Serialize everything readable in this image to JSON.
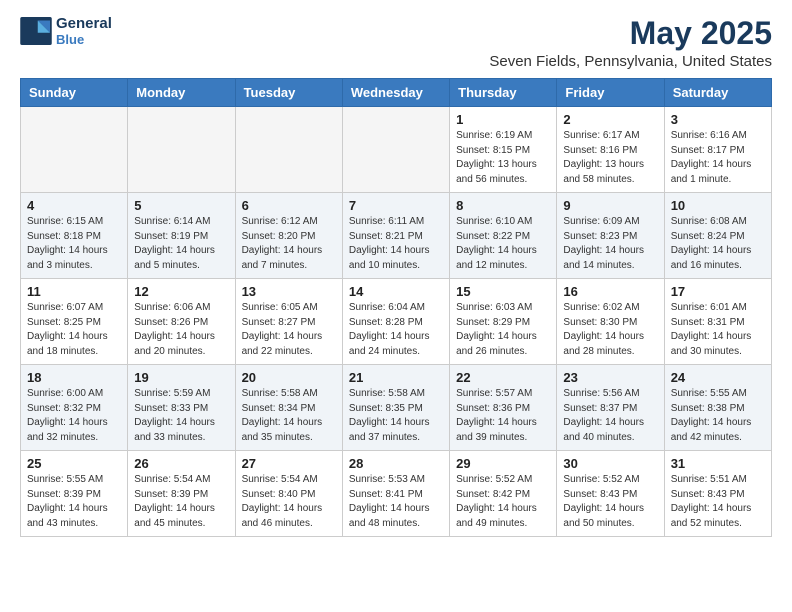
{
  "header": {
    "logo_line1": "General",
    "logo_line2": "Blue",
    "title": "May 2025",
    "subtitle": "Seven Fields, Pennsylvania, United States"
  },
  "days_of_week": [
    "Sunday",
    "Monday",
    "Tuesday",
    "Wednesday",
    "Thursday",
    "Friday",
    "Saturday"
  ],
  "weeks": [
    [
      {
        "day": "",
        "info": ""
      },
      {
        "day": "",
        "info": ""
      },
      {
        "day": "",
        "info": ""
      },
      {
        "day": "",
        "info": ""
      },
      {
        "day": "1",
        "info": "Sunrise: 6:19 AM\nSunset: 8:15 PM\nDaylight: 13 hours\nand 56 minutes."
      },
      {
        "day": "2",
        "info": "Sunrise: 6:17 AM\nSunset: 8:16 PM\nDaylight: 13 hours\nand 58 minutes."
      },
      {
        "day": "3",
        "info": "Sunrise: 6:16 AM\nSunset: 8:17 PM\nDaylight: 14 hours\nand 1 minute."
      }
    ],
    [
      {
        "day": "4",
        "info": "Sunrise: 6:15 AM\nSunset: 8:18 PM\nDaylight: 14 hours\nand 3 minutes."
      },
      {
        "day": "5",
        "info": "Sunrise: 6:14 AM\nSunset: 8:19 PM\nDaylight: 14 hours\nand 5 minutes."
      },
      {
        "day": "6",
        "info": "Sunrise: 6:12 AM\nSunset: 8:20 PM\nDaylight: 14 hours\nand 7 minutes."
      },
      {
        "day": "7",
        "info": "Sunrise: 6:11 AM\nSunset: 8:21 PM\nDaylight: 14 hours\nand 10 minutes."
      },
      {
        "day": "8",
        "info": "Sunrise: 6:10 AM\nSunset: 8:22 PM\nDaylight: 14 hours\nand 12 minutes."
      },
      {
        "day": "9",
        "info": "Sunrise: 6:09 AM\nSunset: 8:23 PM\nDaylight: 14 hours\nand 14 minutes."
      },
      {
        "day": "10",
        "info": "Sunrise: 6:08 AM\nSunset: 8:24 PM\nDaylight: 14 hours\nand 16 minutes."
      }
    ],
    [
      {
        "day": "11",
        "info": "Sunrise: 6:07 AM\nSunset: 8:25 PM\nDaylight: 14 hours\nand 18 minutes."
      },
      {
        "day": "12",
        "info": "Sunrise: 6:06 AM\nSunset: 8:26 PM\nDaylight: 14 hours\nand 20 minutes."
      },
      {
        "day": "13",
        "info": "Sunrise: 6:05 AM\nSunset: 8:27 PM\nDaylight: 14 hours\nand 22 minutes."
      },
      {
        "day": "14",
        "info": "Sunrise: 6:04 AM\nSunset: 8:28 PM\nDaylight: 14 hours\nand 24 minutes."
      },
      {
        "day": "15",
        "info": "Sunrise: 6:03 AM\nSunset: 8:29 PM\nDaylight: 14 hours\nand 26 minutes."
      },
      {
        "day": "16",
        "info": "Sunrise: 6:02 AM\nSunset: 8:30 PM\nDaylight: 14 hours\nand 28 minutes."
      },
      {
        "day": "17",
        "info": "Sunrise: 6:01 AM\nSunset: 8:31 PM\nDaylight: 14 hours\nand 30 minutes."
      }
    ],
    [
      {
        "day": "18",
        "info": "Sunrise: 6:00 AM\nSunset: 8:32 PM\nDaylight: 14 hours\nand 32 minutes."
      },
      {
        "day": "19",
        "info": "Sunrise: 5:59 AM\nSunset: 8:33 PM\nDaylight: 14 hours\nand 33 minutes."
      },
      {
        "day": "20",
        "info": "Sunrise: 5:58 AM\nSunset: 8:34 PM\nDaylight: 14 hours\nand 35 minutes."
      },
      {
        "day": "21",
        "info": "Sunrise: 5:58 AM\nSunset: 8:35 PM\nDaylight: 14 hours\nand 37 minutes."
      },
      {
        "day": "22",
        "info": "Sunrise: 5:57 AM\nSunset: 8:36 PM\nDaylight: 14 hours\nand 39 minutes."
      },
      {
        "day": "23",
        "info": "Sunrise: 5:56 AM\nSunset: 8:37 PM\nDaylight: 14 hours\nand 40 minutes."
      },
      {
        "day": "24",
        "info": "Sunrise: 5:55 AM\nSunset: 8:38 PM\nDaylight: 14 hours\nand 42 minutes."
      }
    ],
    [
      {
        "day": "25",
        "info": "Sunrise: 5:55 AM\nSunset: 8:39 PM\nDaylight: 14 hours\nand 43 minutes."
      },
      {
        "day": "26",
        "info": "Sunrise: 5:54 AM\nSunset: 8:39 PM\nDaylight: 14 hours\nand 45 minutes."
      },
      {
        "day": "27",
        "info": "Sunrise: 5:54 AM\nSunset: 8:40 PM\nDaylight: 14 hours\nand 46 minutes."
      },
      {
        "day": "28",
        "info": "Sunrise: 5:53 AM\nSunset: 8:41 PM\nDaylight: 14 hours\nand 48 minutes."
      },
      {
        "day": "29",
        "info": "Sunrise: 5:52 AM\nSunset: 8:42 PM\nDaylight: 14 hours\nand 49 minutes."
      },
      {
        "day": "30",
        "info": "Sunrise: 5:52 AM\nSunset: 8:43 PM\nDaylight: 14 hours\nand 50 minutes."
      },
      {
        "day": "31",
        "info": "Sunrise: 5:51 AM\nSunset: 8:43 PM\nDaylight: 14 hours\nand 52 minutes."
      }
    ]
  ]
}
